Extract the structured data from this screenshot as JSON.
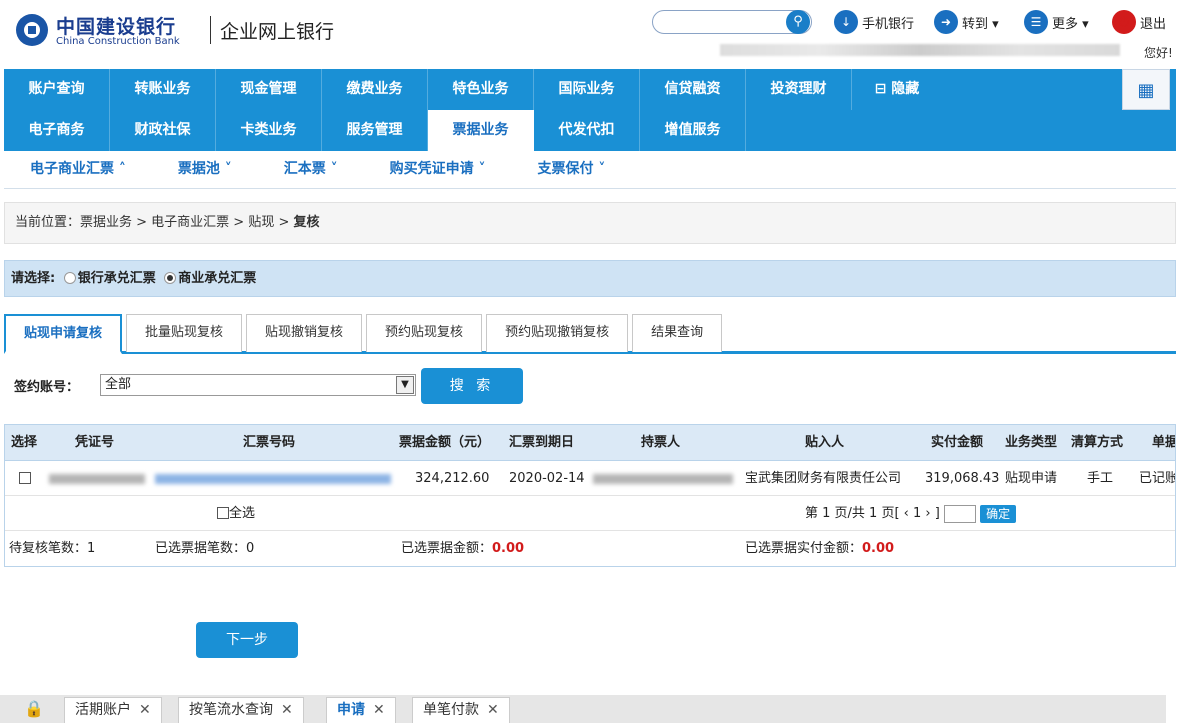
{
  "header": {
    "brand_cn": "中国建设银行",
    "brand_en": "China Construction Bank",
    "brand_sub": "企业网上银行",
    "search_icon": "search-icon",
    "actions": [
      {
        "label": "手机银行",
        "icon": "mobile-bank-icon"
      },
      {
        "label": "转到 ▾",
        "icon": "goto-icon"
      },
      {
        "label": "更多 ▾",
        "icon": "more-icon"
      },
      {
        "label": "退出",
        "icon": "power-icon"
      }
    ],
    "greeting": "您好!"
  },
  "nav": {
    "row1": [
      "账户查询",
      "转账业务",
      "现金管理",
      "缴费业务",
      "特色业务",
      "国际业务",
      "信贷融资",
      "投资理财",
      "⊟ 隐藏"
    ],
    "row2": [
      "电子商务",
      "财政社保",
      "卡类业务",
      "服务管理",
      "票据业务",
      "代发代扣",
      "增值服务"
    ],
    "active": "票据业务"
  },
  "subnav": [
    "电子商业汇票 ˄",
    "票据池 ˅",
    "汇本票 ˅",
    "购买凭证申请 ˅",
    "支票保付 ˅"
  ],
  "breadcrumb": {
    "prefix": "当前位置：票据业务 > 电子商业汇票 > 贴现 > ",
    "current": "复核"
  },
  "select_bar": {
    "label": "请选择:",
    "option1": "银行承兑汇票",
    "option2": "商业承兑汇票",
    "selected": "商业承兑汇票"
  },
  "tabs": [
    "贴现申请复核",
    "批量贴现复核",
    "贴现撤销复核",
    "预约贴现复核",
    "预约贴现撤销复核",
    "结果查询"
  ],
  "active_tab": "贴现申请复核",
  "filter": {
    "label": "签约账号：",
    "value": "全部",
    "search_label": "搜 索"
  },
  "table": {
    "headers": [
      "选择",
      "凭证号",
      "汇票号码",
      "票据金额（元）",
      "汇票到期日",
      "持票人",
      "贴入人",
      "实付金额",
      "业务类型",
      "清算方式",
      "单据"
    ],
    "rows": [
      {
        "amount": "324,212.60",
        "due": "2020-02-14",
        "receiver": "宝武集团财务有限责任公司",
        "paid": "319,068.43",
        "type": "贴现申请",
        "clearing": "手工",
        "status": "已记账"
      }
    ],
    "select_all": "全选",
    "pager": {
      "text": "第 1 页/共 1 页[ ‹ 1 › ]",
      "confirm": "确定"
    },
    "summary": {
      "pending_label": "待复核笔数：",
      "pending_value": "1",
      "selected_count_label": "已选票据笔数：",
      "selected_count_value": "0",
      "selected_amount_label": "已选票据金额：",
      "selected_amount_value": "0.00",
      "selected_paid_label": "已选票据实付金额：",
      "selected_paid_value": "0.00"
    }
  },
  "next_button": "下一步",
  "bottom_tabs": [
    {
      "label": "活期账户",
      "active": false
    },
    {
      "label": "按笔流水查询",
      "active": false
    },
    {
      "label": "申请",
      "active": true
    },
    {
      "label": "单笔付款",
      "active": false
    }
  ],
  "colors": {
    "primary": "#1a90d5",
    "brand": "#1a3d8f",
    "alert": "#d21b1b"
  }
}
